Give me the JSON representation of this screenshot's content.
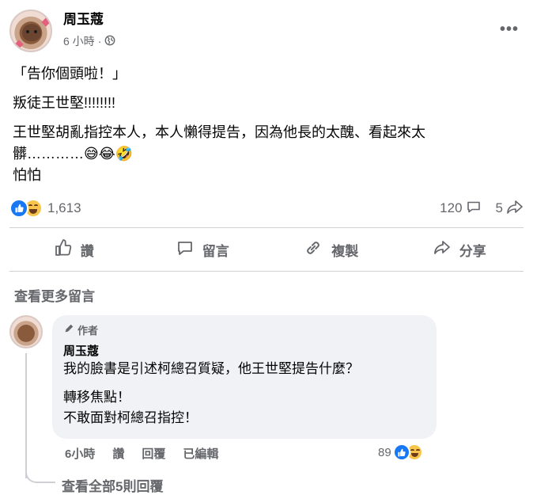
{
  "post": {
    "author": "周玉蔻",
    "time": "6 小時",
    "dot": "·",
    "more_icon": "more-horizontal-icon",
    "body": [
      "「告你個頭啦！」",
      "叛徒王世堅!!!!!!!!",
      "王世堅胡亂指控本人，本人懶得提告，因為他長的太醜、看起來太",
      "髒…………😅😂🤣",
      "怕怕"
    ]
  },
  "stats": {
    "reactions_count": "1,613",
    "comments_count": "120",
    "shares_count": "5"
  },
  "actions": {
    "like": "讚",
    "comment": "留言",
    "copy": "複製",
    "share": "分享"
  },
  "comments": {
    "more_label": "查看更多留言",
    "items": [
      {
        "badge": "作者",
        "author": "周玉蔻",
        "lines": [
          "我的臉書是引述柯總召質疑，他王世堅提告什麼？",
          "轉移焦點！",
          "不敢面對柯總召指控！"
        ],
        "time": "6小時",
        "like_label": "讚",
        "reply_label": "回覆",
        "edited_label": "已編輯",
        "reaction_count": "89"
      }
    ],
    "view_replies_label": "查看全部5則回覆"
  },
  "colors": {
    "facebook_blue": "#1877f2",
    "secondary_text": "#65676b",
    "bubble_bg": "#f0f2f5"
  }
}
